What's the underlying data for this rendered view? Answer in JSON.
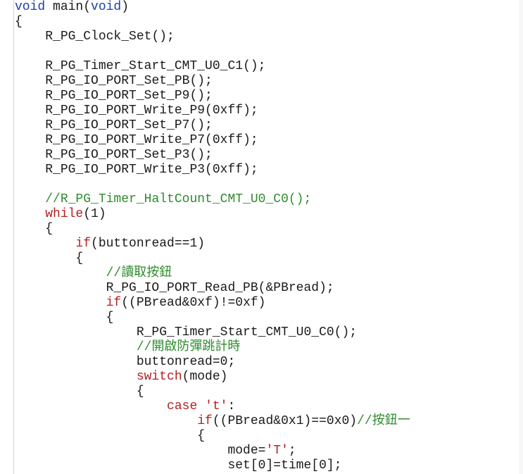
{
  "code_lines": [
    {
      "indent": "",
      "segments": [
        {
          "t": "void",
          "c": "kw-blue"
        },
        {
          "t": " main(",
          "c": ""
        },
        {
          "t": "void",
          "c": "kw-blue"
        },
        {
          "t": ")",
          "c": ""
        }
      ]
    },
    {
      "indent": "",
      "segments": [
        {
          "t": "{",
          "c": ""
        }
      ]
    },
    {
      "indent": "    ",
      "segments": [
        {
          "t": "R_PG_Clock_Set();",
          "c": ""
        }
      ]
    },
    {
      "indent": "",
      "segments": []
    },
    {
      "indent": "    ",
      "segments": [
        {
          "t": "R_PG_Timer_Start_CMT_U0_C1();",
          "c": ""
        }
      ]
    },
    {
      "indent": "    ",
      "segments": [
        {
          "t": "R_PG_IO_PORT_Set_PB();",
          "c": ""
        }
      ]
    },
    {
      "indent": "    ",
      "segments": [
        {
          "t": "R_PG_IO_PORT_Set_P9();",
          "c": ""
        }
      ]
    },
    {
      "indent": "    ",
      "segments": [
        {
          "t": "R_PG_IO_PORT_Write_P9(0xff);",
          "c": ""
        }
      ]
    },
    {
      "indent": "    ",
      "segments": [
        {
          "t": "R_PG_IO_PORT_Set_P7();",
          "c": ""
        }
      ]
    },
    {
      "indent": "    ",
      "segments": [
        {
          "t": "R_PG_IO_PORT_Write_P7(0xff);",
          "c": ""
        }
      ]
    },
    {
      "indent": "    ",
      "segments": [
        {
          "t": "R_PG_IO_PORT_Set_P3();",
          "c": ""
        }
      ]
    },
    {
      "indent": "    ",
      "segments": [
        {
          "t": "R_PG_IO_PORT_Write_P3(0xff);",
          "c": ""
        }
      ]
    },
    {
      "indent": "",
      "segments": []
    },
    {
      "indent": "    ",
      "segments": [
        {
          "t": "//R_PG_Timer_HaltCount_CMT_U0_C0();",
          "c": "cm"
        }
      ]
    },
    {
      "indent": "    ",
      "segments": [
        {
          "t": "while",
          "c": "kw"
        },
        {
          "t": "(1)",
          "c": ""
        }
      ]
    },
    {
      "indent": "    ",
      "segments": [
        {
          "t": "{",
          "c": ""
        }
      ]
    },
    {
      "indent": "        ",
      "segments": [
        {
          "t": "if",
          "c": "kw"
        },
        {
          "t": "(buttonread==1)",
          "c": ""
        }
      ]
    },
    {
      "indent": "        ",
      "segments": [
        {
          "t": "{",
          "c": ""
        }
      ]
    },
    {
      "indent": "            ",
      "segments": [
        {
          "t": "//讀取按鈕",
          "c": "cm"
        }
      ]
    },
    {
      "indent": "            ",
      "segments": [
        {
          "t": "R_PG_IO_PORT_Read_PB(&PBread);",
          "c": ""
        }
      ]
    },
    {
      "indent": "            ",
      "segments": [
        {
          "t": "if",
          "c": "kw"
        },
        {
          "t": "((PBread&0xf)!=0xf)",
          "c": ""
        }
      ]
    },
    {
      "indent": "            ",
      "segments": [
        {
          "t": "{",
          "c": ""
        }
      ]
    },
    {
      "indent": "                ",
      "segments": [
        {
          "t": "R_PG_Timer_Start_CMT_U0_C0();",
          "c": ""
        }
      ]
    },
    {
      "indent": "                ",
      "segments": [
        {
          "t": "//開啟防彈跳計時",
          "c": "cm"
        }
      ]
    },
    {
      "indent": "                ",
      "segments": [
        {
          "t": "buttonread=0;",
          "c": ""
        }
      ]
    },
    {
      "indent": "                ",
      "segments": [
        {
          "t": "switch",
          "c": "kw"
        },
        {
          "t": "(mode)",
          "c": ""
        }
      ]
    },
    {
      "indent": "                ",
      "segments": [
        {
          "t": "{",
          "c": ""
        }
      ]
    },
    {
      "indent": "                    ",
      "segments": [
        {
          "t": "case",
          "c": "kw"
        },
        {
          "t": " ",
          "c": ""
        },
        {
          "t": "'t'",
          "c": "str"
        },
        {
          "t": ":",
          "c": ""
        }
      ]
    },
    {
      "indent": "                        ",
      "segments": [
        {
          "t": "if",
          "c": "kw"
        },
        {
          "t": "((PBread&0x1)==0x0)",
          "c": ""
        },
        {
          "t": "//按鈕一",
          "c": "cm"
        }
      ]
    },
    {
      "indent": "                        ",
      "segments": [
        {
          "t": "{",
          "c": ""
        }
      ]
    },
    {
      "indent": "                            ",
      "segments": [
        {
          "t": "mode=",
          "c": ""
        },
        {
          "t": "'T'",
          "c": "str"
        },
        {
          "t": ";",
          "c": ""
        }
      ]
    },
    {
      "indent": "                            ",
      "segments": [
        {
          "t": "set[0]=time[0];",
          "c": ""
        }
      ]
    }
  ]
}
